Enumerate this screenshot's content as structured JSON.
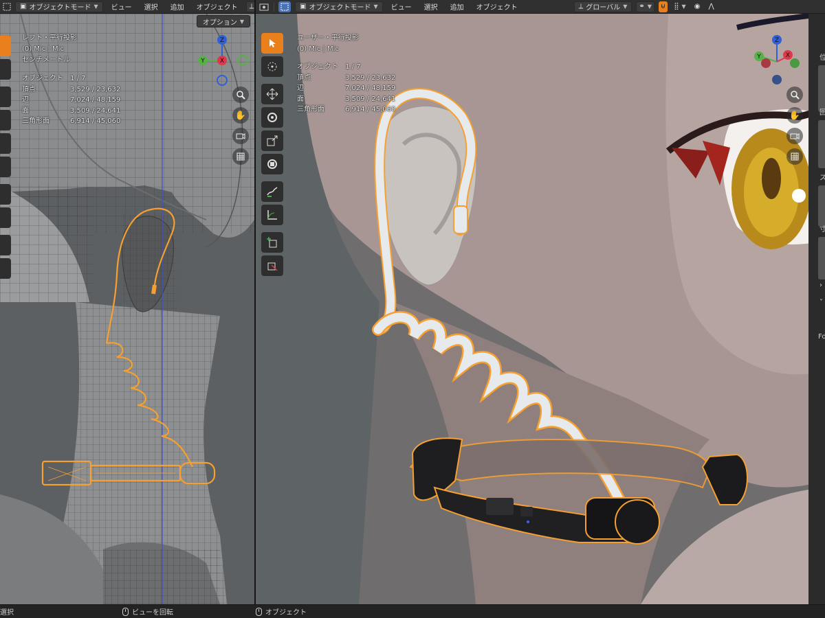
{
  "left_header": {
    "mode": "オブジェクトモード",
    "menu": [
      "ビュー",
      "選択",
      "追加",
      "オブジェクト"
    ],
    "cut_label": "グ",
    "options": "オプション"
  },
  "right_header": {
    "mode": "オブジェクトモード",
    "menu": [
      "ビュー",
      "選択",
      "追加",
      "オブジェクト"
    ],
    "transform_orientation": "グローバル"
  },
  "left_viewport": {
    "view_name": "レフト・平行投影",
    "collection": "(0) Mic | Mic",
    "units": "センチメートル",
    "stats": [
      {
        "label": "オブジェクト",
        "value": "1 / 7"
      },
      {
        "label": "頂点",
        "value": "3,529 / 23,632"
      },
      {
        "label": "辺",
        "value": "7,024 / 48,159"
      },
      {
        "label": "面",
        "value": "3,509 / 24,641"
      },
      {
        "label": "三角形面",
        "value": "6,914 / 45,060"
      }
    ]
  },
  "right_viewport": {
    "view_name": "ユーザー・平行投影",
    "collection": "(0) Mic | Mic",
    "stats": [
      {
        "label": "オブジェクト",
        "value": "1 / 7"
      },
      {
        "label": "頂点",
        "value": "3,529 / 23,632"
      },
      {
        "label": "辺",
        "value": "7,024 / 48,159"
      },
      {
        "label": "面",
        "value": "3,509 / 24,641"
      },
      {
        "label": "三角形面",
        "value": "6,914 / 45,060"
      }
    ]
  },
  "gizmo": {
    "x": "X",
    "y": "Y",
    "z": "Z"
  },
  "side_panel_labels": [
    "位",
    "回",
    "ス",
    "寸",
    "Fo"
  ],
  "status_bar": {
    "left": "選択",
    "middle": "ビューを回転",
    "right": "オブジェクト"
  },
  "colors": {
    "selection_orange": "#f5a030",
    "active_tool": "#e9801b",
    "axis_x": "#e03848",
    "axis_y": "#58b048",
    "axis_z": "#3060d8"
  }
}
